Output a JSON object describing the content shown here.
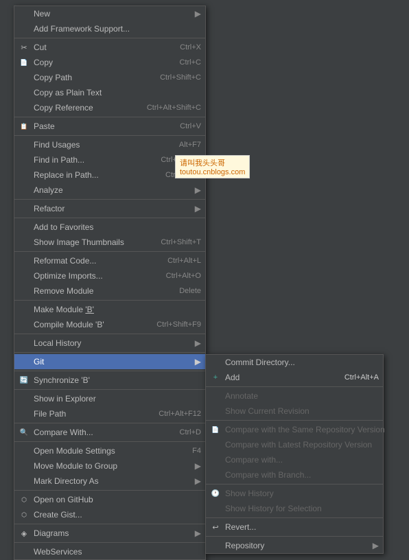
{
  "contextMenu": {
    "items": [
      {
        "id": "new",
        "label": "New",
        "shortcut": "",
        "hasSubmenu": true,
        "icon": ""
      },
      {
        "id": "add-framework",
        "label": "Add Framework Support...",
        "shortcut": "",
        "hasSubmenu": false
      },
      {
        "id": "separator1",
        "type": "separator"
      },
      {
        "id": "cut",
        "label": "Cut",
        "shortcut": "Ctrl+X",
        "hasSubmenu": false,
        "icon": "✂"
      },
      {
        "id": "copy",
        "label": "Copy",
        "shortcut": "Ctrl+C",
        "hasSubmenu": false,
        "icon": "📋"
      },
      {
        "id": "copy-path",
        "label": "Copy Path",
        "shortcut": "Ctrl+Shift+C",
        "hasSubmenu": false
      },
      {
        "id": "copy-plain",
        "label": "Copy as Plain Text",
        "shortcut": "",
        "hasSubmenu": false
      },
      {
        "id": "copy-reference",
        "label": "Copy Reference",
        "shortcut": "Ctrl+Alt+Shift+C",
        "hasSubmenu": false
      },
      {
        "id": "separator2",
        "type": "separator"
      },
      {
        "id": "paste",
        "label": "Paste",
        "shortcut": "Ctrl+V",
        "hasSubmenu": false,
        "icon": "📄"
      },
      {
        "id": "separator3",
        "type": "separator"
      },
      {
        "id": "find-usages",
        "label": "Find Usages",
        "shortcut": "Alt+F7",
        "hasSubmenu": false
      },
      {
        "id": "find-path",
        "label": "Find in Path...",
        "shortcut": "Ctrl+Shift+F",
        "hasSubmenu": false
      },
      {
        "id": "replace-path",
        "label": "Replace in Path...",
        "shortcut": "Ctrl+Shift+",
        "hasSubmenu": false
      },
      {
        "id": "analyze",
        "label": "Analyze",
        "shortcut": "",
        "hasSubmenu": true
      },
      {
        "id": "separator4",
        "type": "separator"
      },
      {
        "id": "refactor",
        "label": "Refactor",
        "shortcut": "",
        "hasSubmenu": true
      },
      {
        "id": "separator5",
        "type": "separator"
      },
      {
        "id": "add-favorites",
        "label": "Add to Favorites",
        "shortcut": "",
        "hasSubmenu": false
      },
      {
        "id": "show-thumbnails",
        "label": "Show Image Thumbnails",
        "shortcut": "Ctrl+Shift+T",
        "hasSubmenu": false
      },
      {
        "id": "separator6",
        "type": "separator"
      },
      {
        "id": "reformat",
        "label": "Reformat Code...",
        "shortcut": "Ctrl+Alt+L",
        "hasSubmenu": false
      },
      {
        "id": "optimize-imports",
        "label": "Optimize Imports...",
        "shortcut": "Ctrl+Alt+O",
        "hasSubmenu": false
      },
      {
        "id": "remove-module",
        "label": "Remove Module",
        "shortcut": "Delete",
        "hasSubmenu": false
      },
      {
        "id": "separator7",
        "type": "separator"
      },
      {
        "id": "make-module",
        "label": "Make Module 'B'",
        "shortcut": "",
        "hasSubmenu": false
      },
      {
        "id": "compile-module",
        "label": "Compile Module 'B'",
        "shortcut": "Ctrl+Shift+F9",
        "hasSubmenu": false
      },
      {
        "id": "separator8",
        "type": "separator"
      },
      {
        "id": "local-history",
        "label": "Local History",
        "shortcut": "",
        "hasSubmenu": true
      },
      {
        "id": "separator9",
        "type": "separator"
      },
      {
        "id": "git",
        "label": "Git",
        "shortcut": "",
        "hasSubmenu": true,
        "highlighted": true
      },
      {
        "id": "separator10",
        "type": "separator"
      },
      {
        "id": "synchronize",
        "label": "Synchronize 'B'",
        "shortcut": "",
        "hasSubmenu": false,
        "icon": "🔄"
      },
      {
        "id": "separator11",
        "type": "separator"
      },
      {
        "id": "show-explorer",
        "label": "Show in Explorer",
        "shortcut": "",
        "hasSubmenu": false
      },
      {
        "id": "file-path",
        "label": "File Path",
        "shortcut": "Ctrl+Alt+F12",
        "hasSubmenu": false
      },
      {
        "id": "separator12",
        "type": "separator"
      },
      {
        "id": "compare-with",
        "label": "Compare With...",
        "shortcut": "Ctrl+D",
        "hasSubmenu": false,
        "icon": "🔍"
      },
      {
        "id": "separator13",
        "type": "separator"
      },
      {
        "id": "open-module-settings",
        "label": "Open Module Settings",
        "shortcut": "F4",
        "hasSubmenu": false
      },
      {
        "id": "move-module",
        "label": "Move Module to Group",
        "shortcut": "",
        "hasSubmenu": true
      },
      {
        "id": "mark-directory",
        "label": "Mark Directory As",
        "shortcut": "",
        "hasSubmenu": true
      },
      {
        "id": "separator14",
        "type": "separator"
      },
      {
        "id": "open-github",
        "label": "Open on GitHub",
        "shortcut": "",
        "hasSubmenu": false,
        "icon": "⬡"
      },
      {
        "id": "create-gist",
        "label": "Create Gist...",
        "shortcut": "",
        "hasSubmenu": false,
        "icon": "⬡"
      },
      {
        "id": "separator15",
        "type": "separator"
      },
      {
        "id": "diagrams",
        "label": "Diagrams",
        "shortcut": "",
        "hasSubmenu": true,
        "icon": "◈"
      },
      {
        "id": "separator16",
        "type": "separator"
      },
      {
        "id": "webservices",
        "label": "WebServices",
        "shortcut": "",
        "hasSubmenu": false
      }
    ]
  },
  "gitSubmenu": {
    "items": [
      {
        "id": "commit-directory",
        "label": "Commit Directory...",
        "shortcut": "",
        "hasSubmenu": false
      },
      {
        "id": "add",
        "label": "Add",
        "shortcut": "Ctrl+Alt+A",
        "hasSubmenu": false,
        "icon": "+"
      },
      {
        "id": "separator1",
        "type": "separator"
      },
      {
        "id": "annotate",
        "label": "Annotate",
        "shortcut": "",
        "disabled": true
      },
      {
        "id": "show-current-revision",
        "label": "Show Current Revision",
        "shortcut": "",
        "disabled": true
      },
      {
        "id": "separator2",
        "type": "separator"
      },
      {
        "id": "compare-same-repo",
        "label": "Compare with the Same Repository Version",
        "shortcut": "",
        "disabled": true
      },
      {
        "id": "compare-latest-repo",
        "label": "Compare with Latest Repository Version",
        "shortcut": "",
        "disabled": true
      },
      {
        "id": "compare-with",
        "label": "Compare with...",
        "shortcut": "",
        "disabled": true
      },
      {
        "id": "compare-branch",
        "label": "Compare with Branch...",
        "shortcut": "",
        "disabled": true
      },
      {
        "id": "separator3",
        "type": "separator"
      },
      {
        "id": "show-history",
        "label": "Show History",
        "shortcut": "",
        "disabled": true,
        "icon": "🕐"
      },
      {
        "id": "show-history-selection",
        "label": "Show History for Selection",
        "shortcut": "",
        "disabled": true
      },
      {
        "id": "separator4",
        "type": "separator"
      },
      {
        "id": "revert",
        "label": "Revert...",
        "shortcut": "",
        "icon": "↩"
      },
      {
        "id": "separator5",
        "type": "separator"
      },
      {
        "id": "repository",
        "label": "Repository",
        "shortcut": "",
        "hasSubmenu": true
      }
    ]
  },
  "watermark": {
    "line1": "请叫我头头哥",
    "line2": "toutou.cnblogs.com"
  }
}
